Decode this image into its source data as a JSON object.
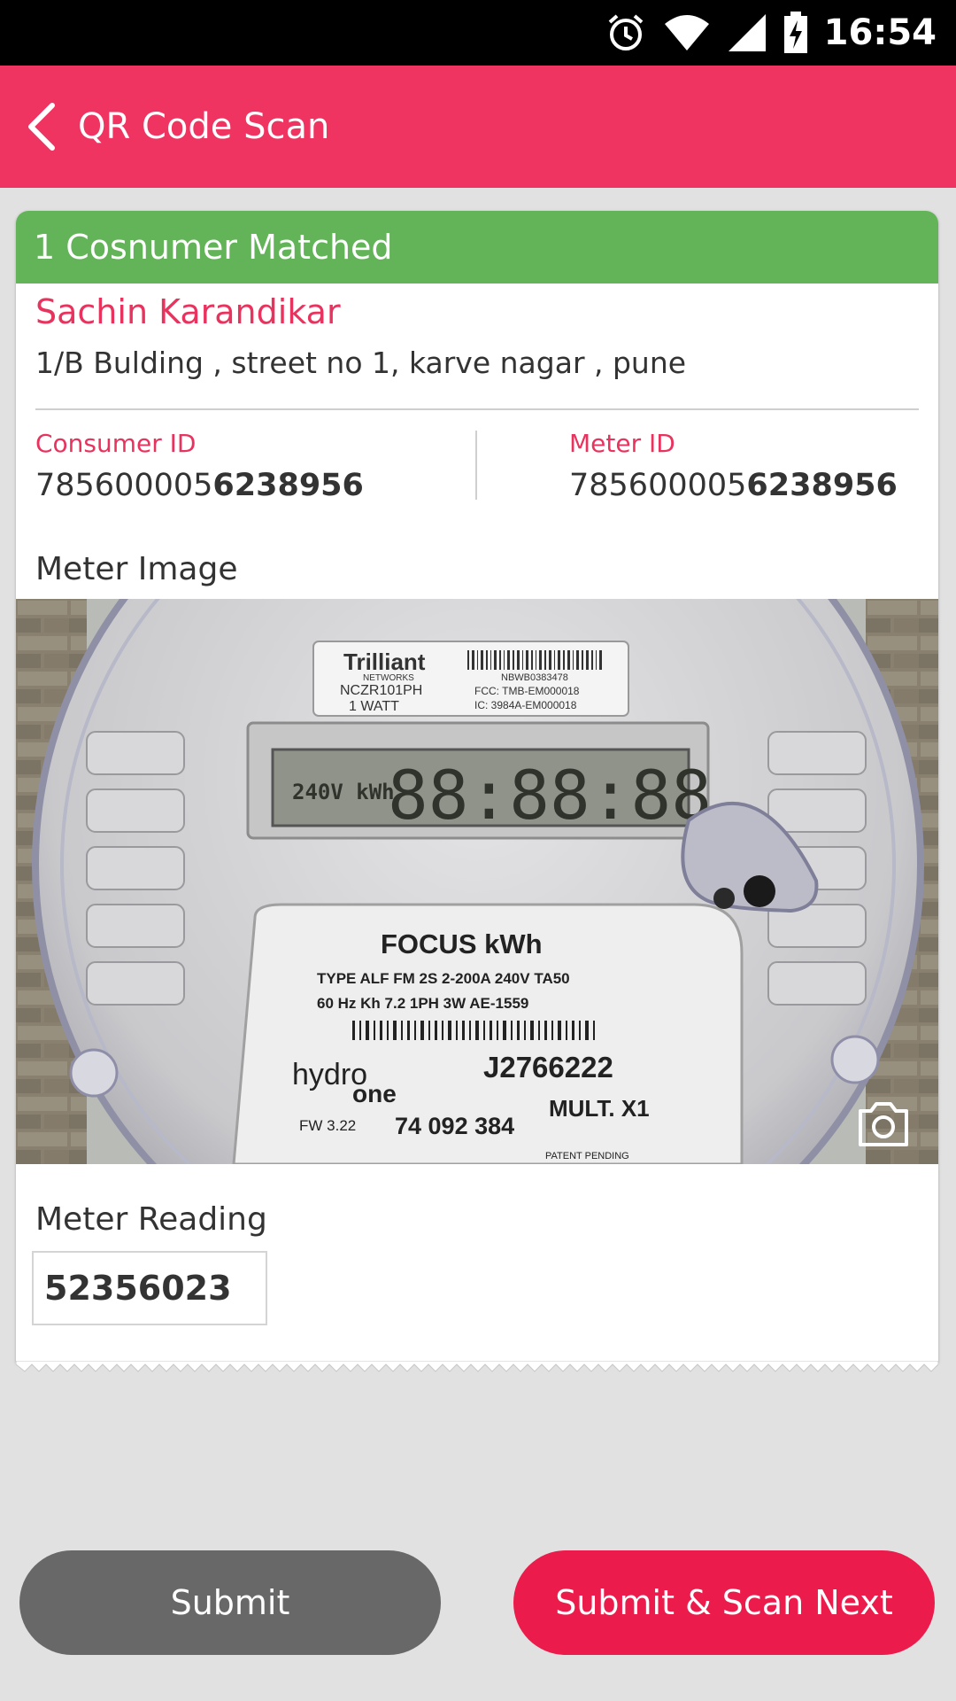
{
  "status_bar": {
    "time": "16:54",
    "icons": [
      "alarm-icon",
      "wifi-icon",
      "signal-icon",
      "battery-charging-icon"
    ]
  },
  "app_bar": {
    "title": "QR Code Scan",
    "back_icon": "back-arrow-icon"
  },
  "consumer_card": {
    "match_banner": "1 Cosnumer Matched",
    "name": "Sachin Karandikar",
    "address": "1/B Bulding , street no 1, karve nagar , pune",
    "consumer_id": {
      "label": "Consumer ID",
      "value_prefix": "785600005",
      "value_bold": "6238956"
    },
    "meter_id": {
      "label": "Meter ID",
      "value_prefix": "785600005",
      "value_bold": "6238956"
    },
    "meter_image_label": "Meter Image",
    "meter_photo": {
      "brand": "Trilliant",
      "brand_sub": "NETWORKS",
      "model": "NCZR101PH",
      "watt": "1 WATT",
      "serial_small": "NBWB0383478",
      "fcc": "FCC: TMB-EM000018",
      "ic": "IC: 3984A-EM000018",
      "display": "88:88:88",
      "display_left": "240V  kWh",
      "focus": "FOCUS kWh",
      "type_line": "TYPE ALF FM 2S 2-200A  240V TA50",
      "hz_line": "60 Hz Kh 7.2 1PH 3W AE-1559",
      "hydro": "hydro",
      "one": "one",
      "meter_no": "J2766222",
      "fw": "FW 3.22",
      "number": "74 092 384",
      "mult": "MULT. X1",
      "patent": "PATENT PENDING"
    },
    "camera_icon": "camera-icon",
    "meter_reading_label": "Meter Reading",
    "meter_reading_value": "52356023"
  },
  "actions": {
    "submit": "Submit",
    "submit_next": "Submit & Scan Next"
  },
  "colors": {
    "app_bar": "#ef3461",
    "match_banner": "#63b359",
    "accent_text": "#e8335e",
    "submit_button": "#686868",
    "submit_next_button": "#eb1b4b"
  }
}
